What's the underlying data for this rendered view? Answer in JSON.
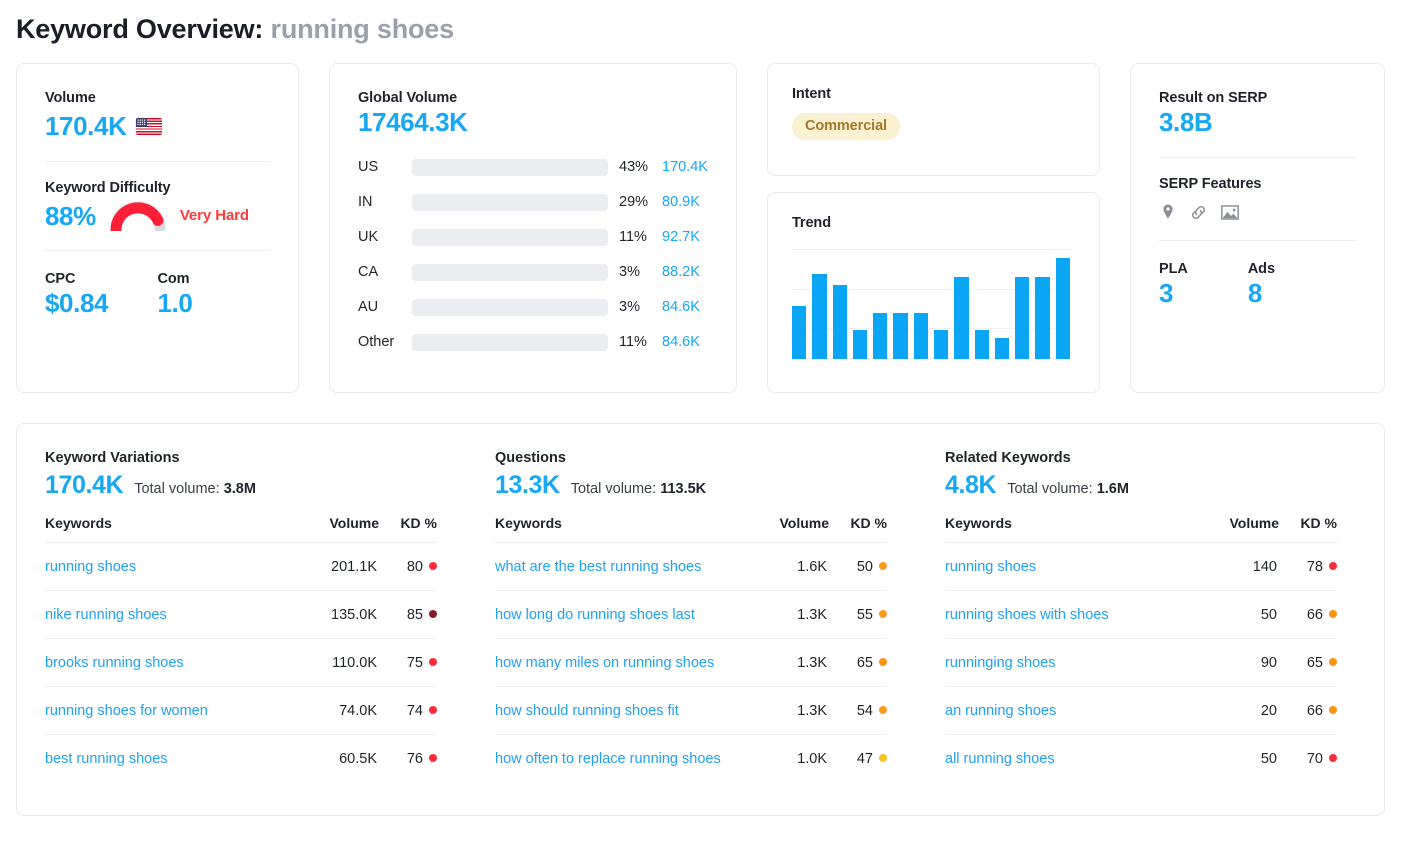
{
  "header": {
    "prefix": "Keyword Overview:",
    "keyword": "running shoes"
  },
  "colors": {
    "blue": "#16a7f5",
    "bar_blue": "#0aa5f5",
    "link_blue": "#1fa2f0",
    "red": "#ff3b3b",
    "badge_bg": "#faf0d2",
    "badge_text": "#a5792a"
  },
  "volume_card": {
    "volume_label": "Volume",
    "volume_value": "170.4K",
    "flag": "us-flag-icon",
    "kd_label": "Keyword Difficulty",
    "kd_value": "88%",
    "kd_percent": 88,
    "kd_word": "Very Hard",
    "cpc_label": "CPC",
    "cpc_value": "$0.84",
    "com_label": "Com",
    "com_value": "1.0"
  },
  "global_volume": {
    "label": "Global Volume",
    "value": "17464.3K",
    "rows": [
      {
        "country": "US",
        "pct": "43%",
        "volume": "170.4K",
        "fill": 50
      },
      {
        "country": "IN",
        "pct": "29%",
        "volume": "80.9K",
        "fill": 22
      },
      {
        "country": "UK",
        "pct": "11%",
        "volume": "92.7K",
        "fill": 24
      },
      {
        "country": "CA",
        "pct": "3%",
        "volume": "88.2K",
        "fill": 8
      },
      {
        "country": "AU",
        "pct": "3%",
        "volume": "84.6K",
        "fill": 8
      },
      {
        "country": "Other",
        "pct": "11%",
        "volume": "84.6K",
        "fill": 21
      }
    ]
  },
  "intent": {
    "label": "Intent",
    "value": "Commercial"
  },
  "trend": {
    "label": "Trend",
    "chart_data": {
      "type": "bar",
      "title": "Trend",
      "xlabel": "",
      "ylabel": "",
      "grid": true,
      "categories": [
        "1",
        "2",
        "3",
        "4",
        "5",
        "6",
        "7",
        "8",
        "9",
        "10",
        "11",
        "12",
        "13",
        "14"
      ],
      "values": [
        48,
        77,
        67,
        26,
        42,
        42,
        42,
        26,
        75,
        26,
        19,
        75,
        75,
        92
      ],
      "ylim": [
        0,
        100
      ]
    }
  },
  "serp": {
    "result_label": "Result on SERP",
    "result_value": "3.8B",
    "features_label": "SERP Features",
    "features": [
      "map-pin-icon",
      "link-icon",
      "image-icon"
    ],
    "pla_label": "PLA",
    "pla_value": "3",
    "ads_label": "Ads",
    "ads_value": "8"
  },
  "tables": {
    "headers": {
      "keywords": "Keywords",
      "volume": "Volume",
      "kd": "KD %"
    },
    "total_label": "Total volume:",
    "variations": {
      "title": "Keyword Variations",
      "count": "170.4K",
      "total_volume": "3.8M",
      "rows": [
        {
          "keyword": "running shoes",
          "volume": "201.1K",
          "kd": "80",
          "dot": "#fa2d3c"
        },
        {
          "keyword": "nike running shoes",
          "volume": "135.0K",
          "kd": "85",
          "dot": "#8b1c28"
        },
        {
          "keyword": "brooks running shoes",
          "volume": "110.0K",
          "kd": "75",
          "dot": "#fa2d3c"
        },
        {
          "keyword": "running shoes for women",
          "volume": "74.0K",
          "kd": "74",
          "dot": "#fa2d3c"
        },
        {
          "keyword": "best running shoes",
          "volume": "60.5K",
          "kd": "76",
          "dot": "#fa2d3c"
        }
      ]
    },
    "questions": {
      "title": "Questions",
      "count": "13.3K",
      "total_volume": "113.5K",
      "rows": [
        {
          "keyword": "what are the best running shoes",
          "volume": "1.6K",
          "kd": "50",
          "dot": "#fb9a20"
        },
        {
          "keyword": "how long do running shoes last",
          "volume": "1.3K",
          "kd": "55",
          "dot": "#fb9a20"
        },
        {
          "keyword": "how many miles on running shoes",
          "volume": "1.3K",
          "kd": "65",
          "dot": "#fb9310"
        },
        {
          "keyword": "how should running shoes fit",
          "volume": "1.3K",
          "kd": "54",
          "dot": "#fb9a20"
        },
        {
          "keyword": "how often to replace running shoes",
          "volume": "1.0K",
          "kd": "47",
          "dot": "#fdc023"
        }
      ]
    },
    "related": {
      "title": "Related Keywords",
      "count": "4.8K",
      "total_volume": "1.6M",
      "rows": [
        {
          "keyword": "running shoes",
          "volume": "140",
          "kd": "78",
          "dot": "#fa2d3c"
        },
        {
          "keyword": "running shoes with shoes",
          "volume": "50",
          "kd": "66",
          "dot": "#fb9310"
        },
        {
          "keyword": "runninging shoes",
          "volume": "90",
          "kd": "65",
          "dot": "#fb9310"
        },
        {
          "keyword": "an running shoes",
          "volume": "20",
          "kd": "66",
          "dot": "#fb9310"
        },
        {
          "keyword": "all running shoes",
          "volume": "50",
          "kd": "70",
          "dot": "#fa2d3c"
        }
      ]
    }
  }
}
